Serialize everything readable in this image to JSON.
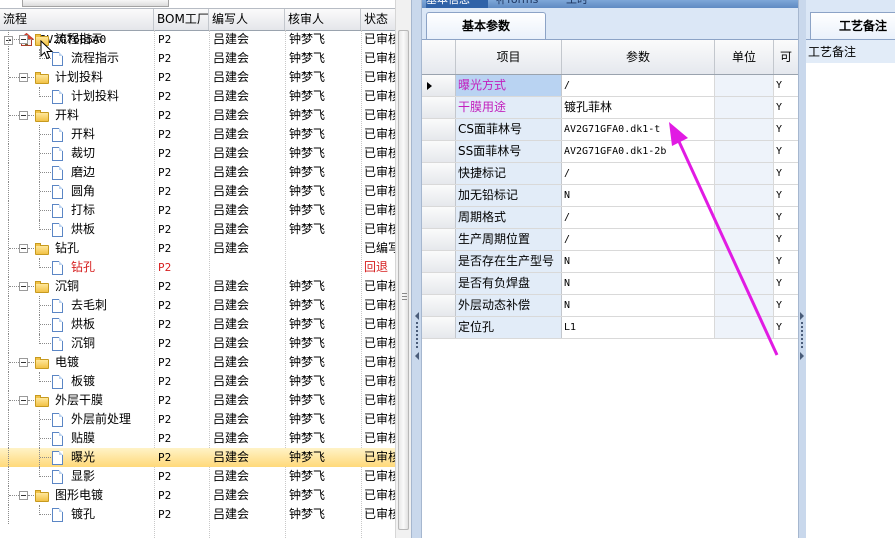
{
  "tree_grid": {
    "columns": [
      "流程",
      "BOM工厂",
      "编写人",
      "核审人",
      "状态"
    ],
    "root": "2V2G76B5A0",
    "rows": [
      {
        "label": "流程指示",
        "level": 1,
        "type": "folder",
        "bom": "P2",
        "editor": "吕建会",
        "reviewer": "钟梦飞",
        "status": "已审核"
      },
      {
        "label": "流程指示",
        "level": 2,
        "type": "doc",
        "bom": "P2",
        "editor": "吕建会",
        "reviewer": "钟梦飞",
        "status": "已审核"
      },
      {
        "label": "计划投料",
        "level": 1,
        "type": "folder",
        "bom": "P2",
        "editor": "吕建会",
        "reviewer": "钟梦飞",
        "status": "已审核"
      },
      {
        "label": "计划投料",
        "level": 2,
        "type": "doc",
        "bom": "P2",
        "editor": "吕建会",
        "reviewer": "钟梦飞",
        "status": "已审核"
      },
      {
        "label": "开料",
        "level": 1,
        "type": "folder",
        "bom": "P2",
        "editor": "吕建会",
        "reviewer": "钟梦飞",
        "status": "已审核"
      },
      {
        "label": "开料",
        "level": 2,
        "type": "doc",
        "bom": "P2",
        "editor": "吕建会",
        "reviewer": "钟梦飞",
        "status": "已审核"
      },
      {
        "label": "裁切",
        "level": 2,
        "type": "doc",
        "bom": "P2",
        "editor": "吕建会",
        "reviewer": "钟梦飞",
        "status": "已审核"
      },
      {
        "label": "磨边",
        "level": 2,
        "type": "doc",
        "bom": "P2",
        "editor": "吕建会",
        "reviewer": "钟梦飞",
        "status": "已审核"
      },
      {
        "label": "圆角",
        "level": 2,
        "type": "doc",
        "bom": "P2",
        "editor": "吕建会",
        "reviewer": "钟梦飞",
        "status": "已审核"
      },
      {
        "label": "打标",
        "level": 2,
        "type": "doc",
        "bom": "P2",
        "editor": "吕建会",
        "reviewer": "钟梦飞",
        "status": "已审核"
      },
      {
        "label": "烘板",
        "level": 2,
        "type": "doc",
        "bom": "P2",
        "editor": "吕建会",
        "reviewer": "钟梦飞",
        "status": "已审核"
      },
      {
        "label": "钻孔",
        "level": 1,
        "type": "folder",
        "bom": "P2",
        "editor": "吕建会",
        "reviewer": "",
        "status": "已编写"
      },
      {
        "label": "钻孔",
        "level": 2,
        "type": "doc",
        "bom": "P2",
        "editor": "",
        "reviewer": "",
        "status": "回退",
        "red": true
      },
      {
        "label": "沉铜",
        "level": 1,
        "type": "folder",
        "bom": "P2",
        "editor": "吕建会",
        "reviewer": "钟梦飞",
        "status": "已审核"
      },
      {
        "label": "去毛刺",
        "level": 2,
        "type": "doc",
        "bom": "P2",
        "editor": "吕建会",
        "reviewer": "钟梦飞",
        "status": "已审核"
      },
      {
        "label": "烘板",
        "level": 2,
        "type": "doc",
        "bom": "P2",
        "editor": "吕建会",
        "reviewer": "钟梦飞",
        "status": "已审核"
      },
      {
        "label": "沉铜",
        "level": 2,
        "type": "doc",
        "bom": "P2",
        "editor": "吕建会",
        "reviewer": "钟梦飞",
        "status": "已审核"
      },
      {
        "label": "电镀",
        "level": 1,
        "type": "folder",
        "bom": "P2",
        "editor": "吕建会",
        "reviewer": "钟梦飞",
        "status": "已审核"
      },
      {
        "label": "板镀",
        "level": 2,
        "type": "doc",
        "bom": "P2",
        "editor": "吕建会",
        "reviewer": "钟梦飞",
        "status": "已审核"
      },
      {
        "label": "外层干膜",
        "level": 1,
        "type": "folder",
        "bom": "P2",
        "editor": "吕建会",
        "reviewer": "钟梦飞",
        "status": "已审核"
      },
      {
        "label": "外层前处理",
        "level": 2,
        "type": "doc",
        "bom": "P2",
        "editor": "吕建会",
        "reviewer": "钟梦飞",
        "status": "已审核"
      },
      {
        "label": "贴膜",
        "level": 2,
        "type": "doc",
        "bom": "P2",
        "editor": "吕建会",
        "reviewer": "钟梦飞",
        "status": "已审核"
      },
      {
        "label": "曝光",
        "level": 2,
        "type": "doc",
        "bom": "P2",
        "editor": "吕建会",
        "reviewer": "钟梦飞",
        "status": "已审核",
        "selected": true
      },
      {
        "label": "显影",
        "level": 2,
        "type": "doc",
        "bom": "P2",
        "editor": "吕建会",
        "reviewer": "钟梦飞",
        "status": "已审核"
      },
      {
        "label": "图形电镀",
        "level": 1,
        "type": "folder",
        "bom": "P2",
        "editor": "吕建会",
        "reviewer": "钟梦飞",
        "status": "已审核"
      },
      {
        "label": "镀孔",
        "level": 2,
        "type": "doc",
        "bom": "P2",
        "editor": "吕建会",
        "reviewer": "钟梦飞",
        "status": "已审核"
      }
    ]
  },
  "right_tabs": {
    "top": [
      "基本信息",
      "补forms",
      "工时"
    ],
    "active_sub": "基本参数"
  },
  "param_grid": {
    "columns": [
      "项目",
      "参数",
      "单位",
      "可"
    ],
    "rows": [
      {
        "item": "曝光方式",
        "param": "/",
        "unit": "",
        "flag": "Y",
        "magenta": true
      },
      {
        "item": "干膜用途",
        "param": "镀孔菲林",
        "unit": "",
        "flag": "Y",
        "magenta": true
      },
      {
        "item": "CS面菲林号",
        "param": "AV2G71GFA0.dk1-t",
        "unit": "",
        "flag": "Y"
      },
      {
        "item": "SS面菲林号",
        "param": "AV2G71GFA0.dk1-2b",
        "unit": "",
        "flag": "Y"
      },
      {
        "item": "快捷标记",
        "param": "/",
        "unit": "",
        "flag": "Y"
      },
      {
        "item": "加无铅标记",
        "param": "N",
        "unit": "",
        "flag": "Y"
      },
      {
        "item": "周期格式",
        "param": "/",
        "unit": "",
        "flag": "Y"
      },
      {
        "item": "生产周期位置",
        "param": "/",
        "unit": "",
        "flag": "Y"
      },
      {
        "item": "是否存在生产型号",
        "param": "N",
        "unit": "",
        "flag": "Y"
      },
      {
        "item": "是否有负焊盘",
        "param": "N",
        "unit": "",
        "flag": "Y"
      },
      {
        "item": "外层动态补偿",
        "param": "N",
        "unit": "",
        "flag": "Y"
      },
      {
        "item": "定位孔",
        "param": "L1",
        "unit": "",
        "flag": "Y"
      }
    ]
  },
  "craft_panel": {
    "tab": "工艺备注",
    "header": "工艺备注"
  },
  "colors": {
    "annotation_arrow": "#e11be3",
    "magenta_text": "#c21fbd",
    "rollback_red": "#d61f1f",
    "selection": "#ffd97a"
  }
}
